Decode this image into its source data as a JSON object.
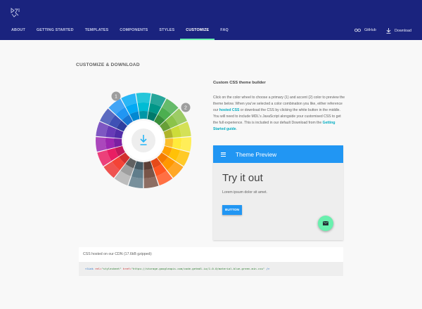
{
  "nav": {
    "tabs": [
      {
        "label": "ABOUT",
        "active": false
      },
      {
        "label": "GETTING STARTED",
        "active": false
      },
      {
        "label": "TEMPLATES",
        "active": false
      },
      {
        "label": "COMPONENTS",
        "active": false
      },
      {
        "label": "STYLES",
        "active": false
      },
      {
        "label": "CUSTOMIZE",
        "active": true
      },
      {
        "label": "FAQ",
        "active": false
      }
    ],
    "github_label": "GitHub",
    "download_label": "Download"
  },
  "page": {
    "title": "CUSTOMIZE & DOWNLOAD"
  },
  "wheel": {
    "marker_primary": "1",
    "marker_accent": "2",
    "download_icon": "download-icon"
  },
  "description": {
    "title": "Custom CSS theme builder",
    "p1": "Click on the color wheel to choose a primary (1) and accent (2) color to preview the theme below. When you've selected a color combination you like, either reference our ",
    "link1": "hosted CSS",
    "p2": " or download the CSS by clicking the white button in the middle. You will need to include MDL's JavaScript alongside your customised CSS to get the full experience. This is included in our default Download from the ",
    "link2": "Getting Started guide",
    "p3": "."
  },
  "preview": {
    "bar_title": "Theme Preview",
    "heading": "Try it out",
    "text": "Lorem ipsum dolor sit amet.",
    "button_label": "BUTTON",
    "fab_icon": "email-icon",
    "primary_color": "#2196f3",
    "accent_color": "#69f0ae"
  },
  "cdn": {
    "label": "CSS hosted on our CDN (17.6kB gzipped):",
    "code_open": "<link ",
    "code_attr1": "rel=",
    "code_val1": "\"stylesheet\"",
    "code_attr2": " href=",
    "code_val2": "\"https://storage.googleapis.com/code.getmdl.io/1.0.0/material.blue-green.min.css\"",
    "code_close": " />"
  },
  "colors": {
    "header_bg": "#1a237e",
    "accent_underline": "#69f0ae",
    "link": "#00acc1"
  }
}
